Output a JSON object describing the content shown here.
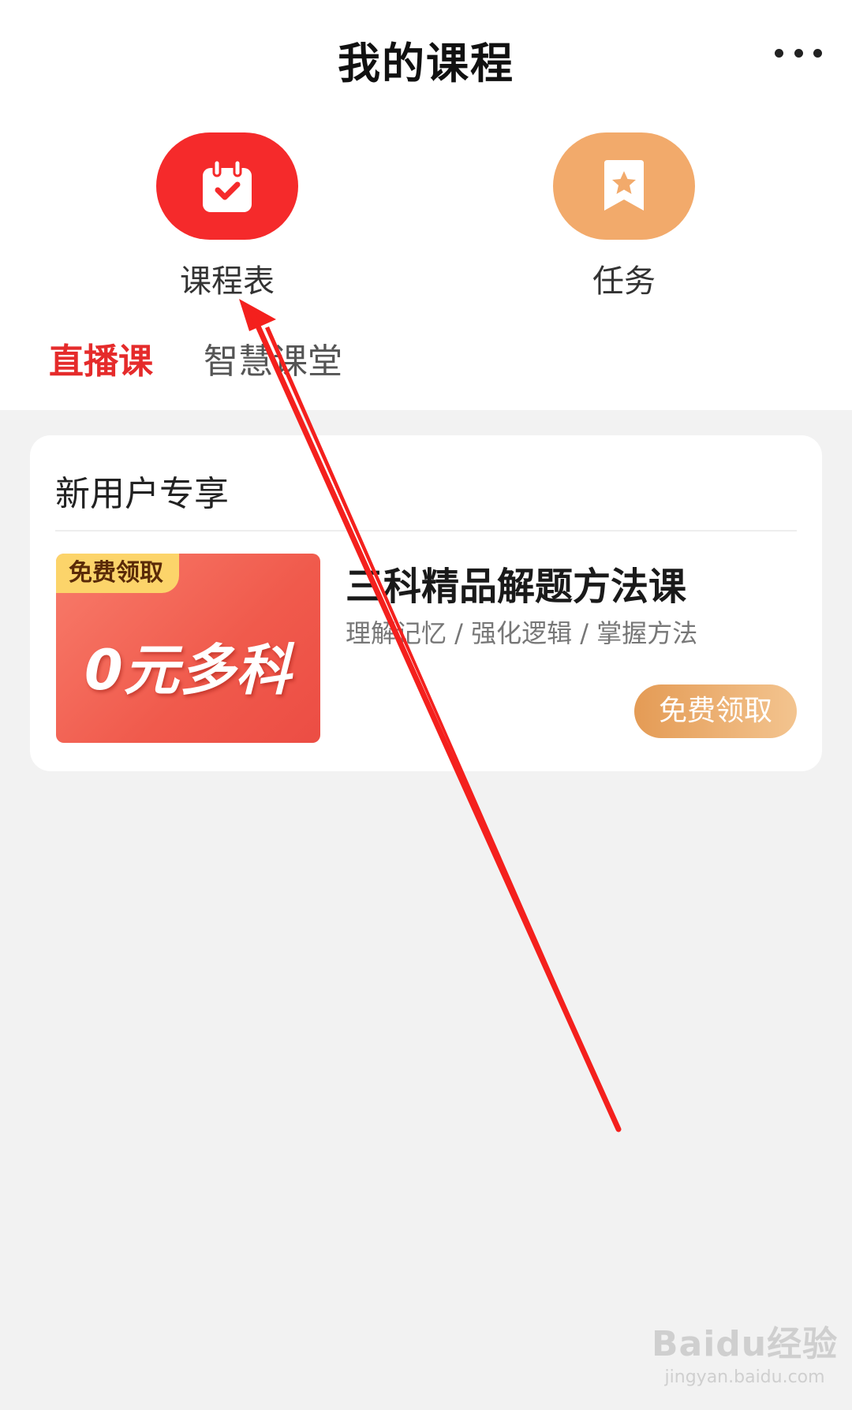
{
  "header": {
    "title": "我的课程"
  },
  "entries": [
    {
      "label": "课程表",
      "icon": "calendar-check-icon",
      "color": "#f52a2b"
    },
    {
      "label": "任务",
      "icon": "bookmark-star-icon",
      "color": "#f2aa6b"
    }
  ],
  "tabs": [
    {
      "label": "直播课",
      "active": true
    },
    {
      "label": "智慧课堂",
      "active": false
    }
  ],
  "card": {
    "title": "新用户专享",
    "promo_badge": "免费领取",
    "promo_main": "0元多科",
    "course_title": "三科精品解题方法课",
    "course_subtitle": "理解记忆 / 强化逻辑 / 掌握方法",
    "button_label": "免费领取"
  },
  "watermark": {
    "logo": "Baidu经验",
    "url": "jingyan.baidu.com"
  },
  "colors": {
    "accent": "#e52b2b",
    "button": "#e49b55",
    "background": "#f2f2f2"
  }
}
